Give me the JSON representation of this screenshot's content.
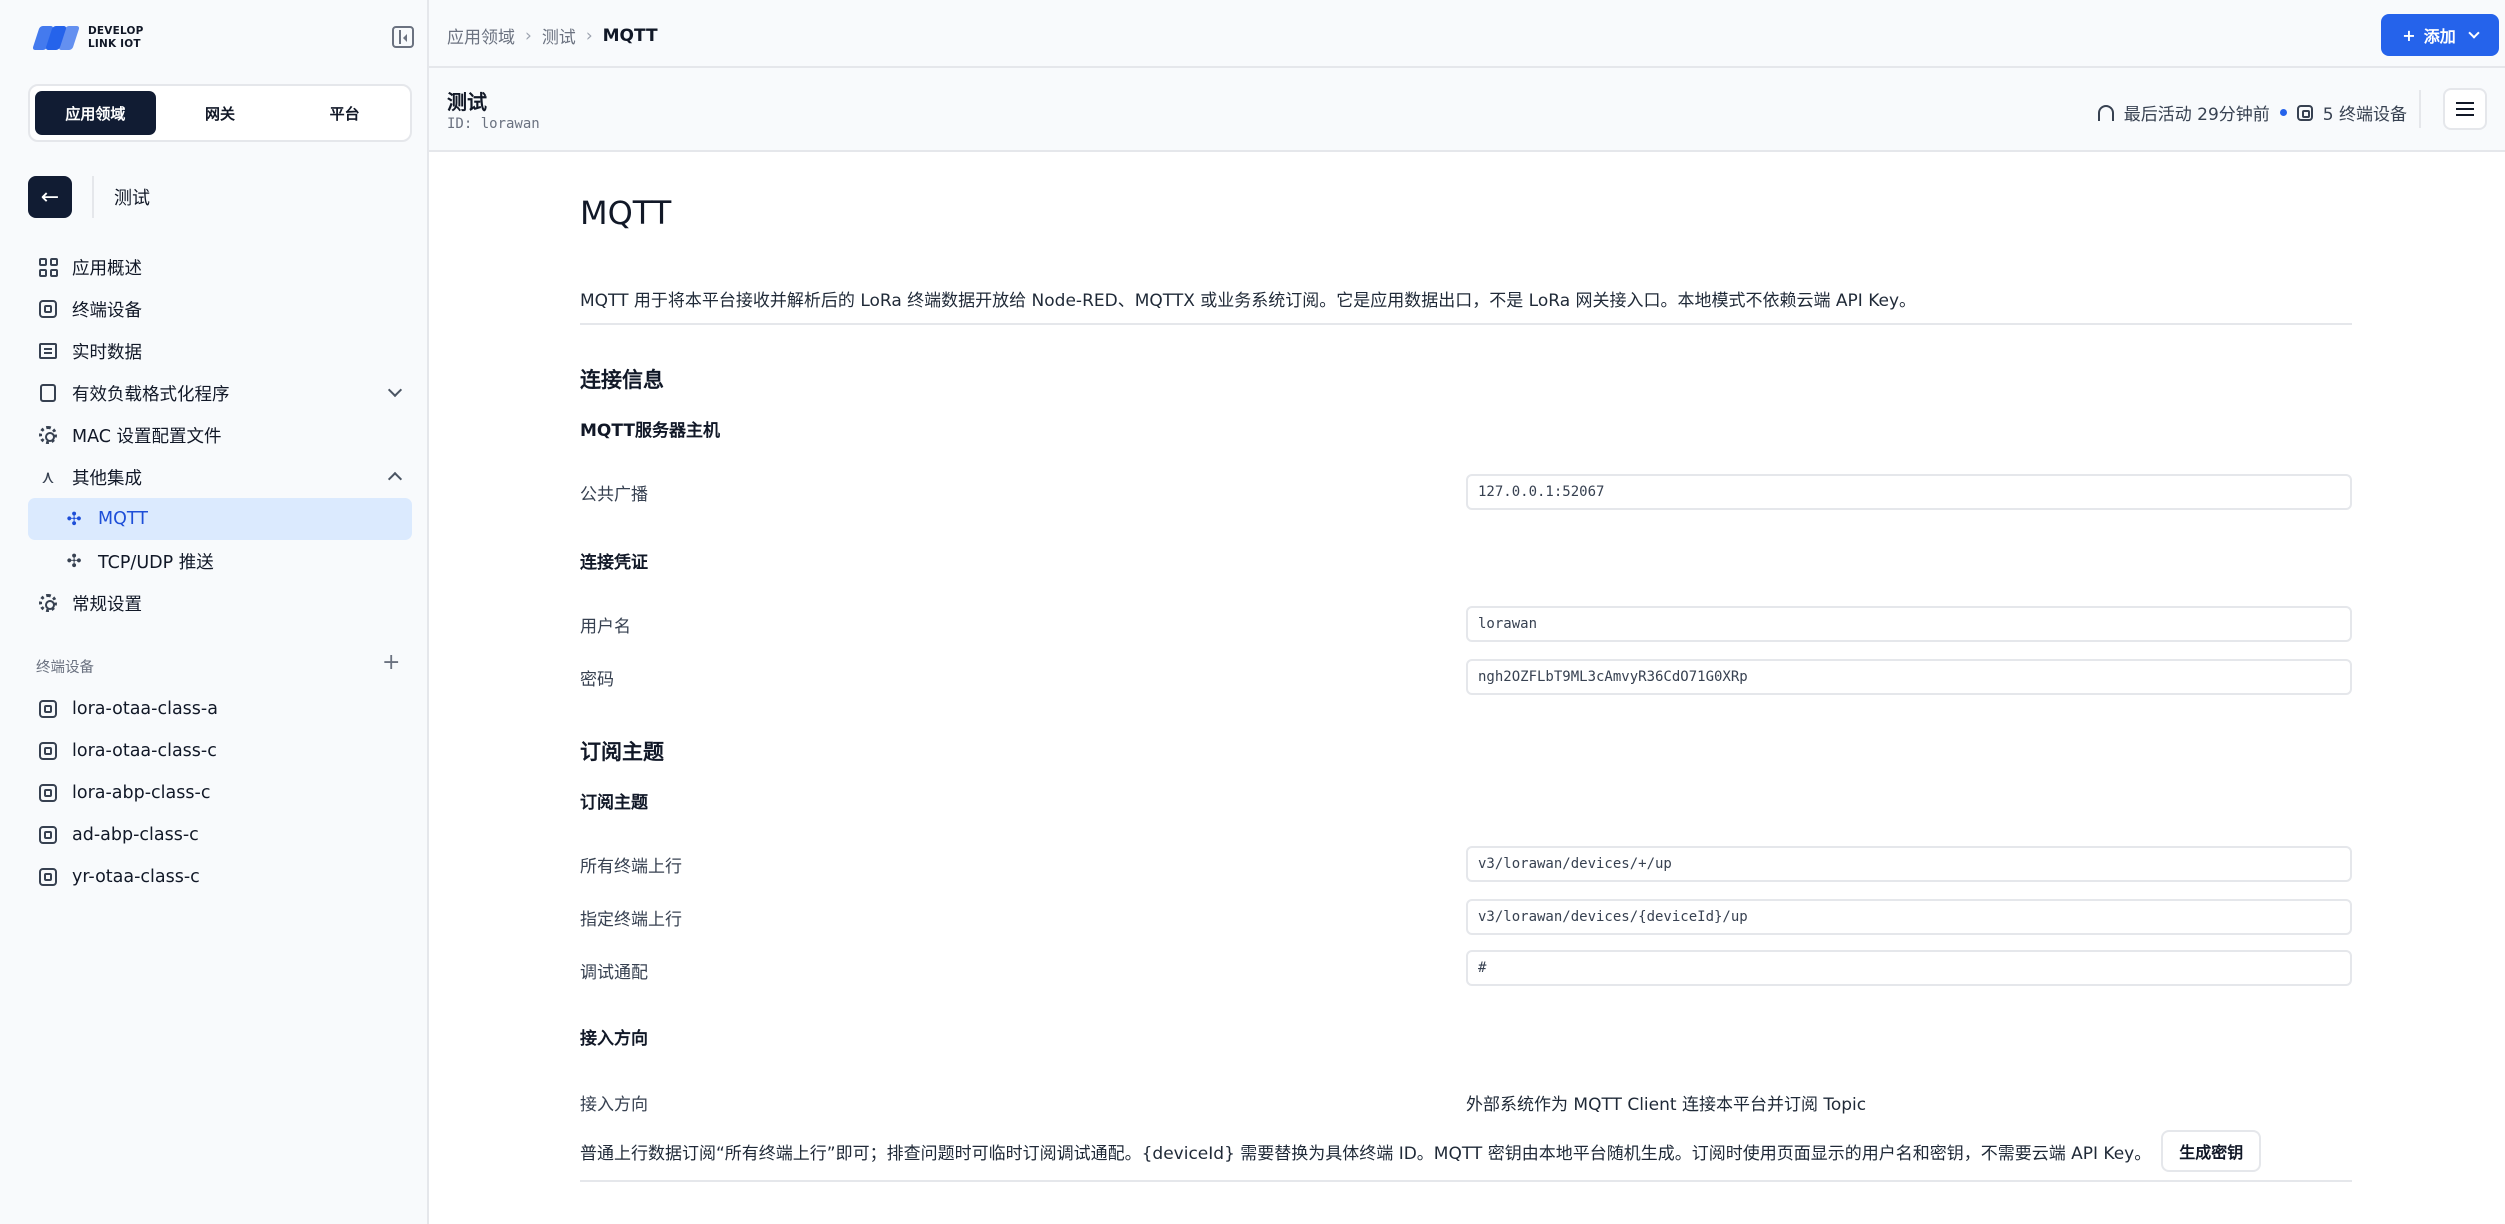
{
  "brand": {
    "line1": "DEVELOP",
    "line2": "LINK IOT"
  },
  "segments": [
    {
      "label": "应用领域",
      "active": true
    },
    {
      "label": "网关",
      "active": false
    },
    {
      "label": "平台",
      "active": false
    }
  ],
  "app": {
    "name": "测试"
  },
  "nav": [
    {
      "label": "应用概述",
      "icon": "dashboard-icon"
    },
    {
      "label": "终端设备",
      "icon": "chip-icon"
    },
    {
      "label": "实时数据",
      "icon": "list-icon"
    },
    {
      "label": "有效负载格式化程序",
      "icon": "clipboard-icon",
      "expand": "down"
    },
    {
      "label": "MAC 设置配置文件",
      "icon": "gear-icon"
    },
    {
      "label": "其他集成",
      "icon": "integration-icon",
      "expand": "up"
    },
    {
      "label": "MQTT",
      "icon": "puzzle-icon",
      "sub": true,
      "active": true
    },
    {
      "label": "TCP/UDP 推送",
      "icon": "puzzle-icon",
      "sub": true
    },
    {
      "label": "常规设置",
      "icon": "gear-icon"
    }
  ],
  "devices_section": {
    "label": "终端设备"
  },
  "devices": [
    "lora-otaa-class-a",
    "lora-otaa-class-c",
    "lora-abp-class-c",
    "ad-abp-class-c",
    "yr-otaa-class-c"
  ],
  "breadcrumb": {
    "root": "应用领域",
    "parent": "测试",
    "current": "MQTT"
  },
  "add_button": "添加",
  "subheader": {
    "title": "测试",
    "id": "ID: lorawan",
    "last_activity": "最后活动 29分钟前",
    "device_count": "5 终端设备"
  },
  "page": {
    "title": "MQTT",
    "description": "MQTT 用于将本平台接收并解析后的 LoRa 终端数据开放给 Node-RED、MQTTX 或业务系统订阅。它是应用数据出口，不是 LoRa 网关接入口。本地模式不依赖云端 API Key。",
    "connection": {
      "heading": "连接信息",
      "host_heading": "MQTT服务器主机",
      "public_label": "公共广播",
      "public_value": "127.0.0.1:52067",
      "cred_heading": "连接凭证",
      "username_label": "用户名",
      "username_value": "lorawan",
      "password_label": "密码",
      "password_value": "ngh2OZFLbT9ML3cAmvyR36CdO71G0XRp"
    },
    "topics": {
      "heading": "订阅主题",
      "sub_heading": "订阅主题",
      "all_label": "所有终端上行",
      "all_value": "v3/lorawan/devices/+/up",
      "one_label": "指定终端上行",
      "one_value": "v3/lorawan/devices/{deviceId}/up",
      "debug_label": "调试通配",
      "debug_value": "#"
    },
    "direction": {
      "heading": "接入方向",
      "label": "接入方向",
      "value": "外部系统作为 MQTT Client 连接本平台并订阅 Topic"
    },
    "note": "普通上行数据订阅“所有终端上行”即可；排查问题时可临时订阅调试通配。{deviceId} 需要替换为具体终端 ID。MQTT 密钥由本地平台随机生成。订阅时使用页面显示的用户名和密钥，不需要云端 API Key。",
    "generate_button": "生成密钥"
  }
}
